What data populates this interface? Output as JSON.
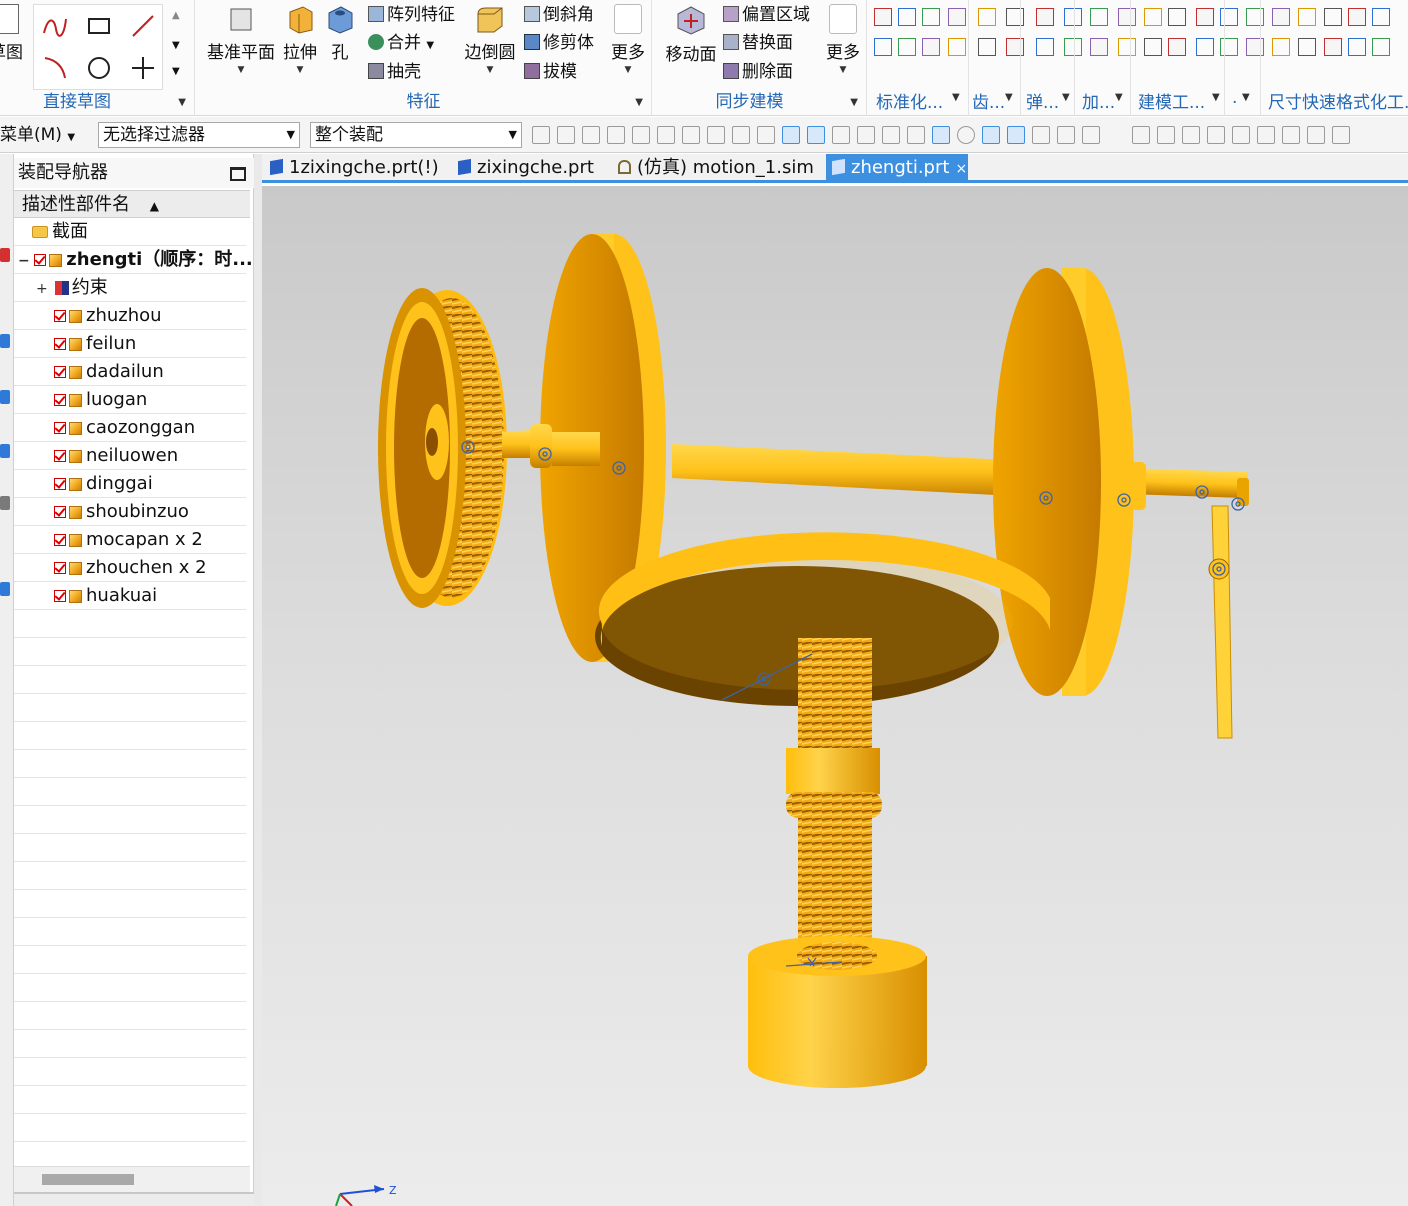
{
  "ribbon": {
    "groups": {
      "direct_sketch": {
        "label": "直接草图",
        "partial_left_label": "草图"
      },
      "feature": {
        "label": "特征",
        "datum_plane": "基准平面",
        "extrude": "拉伸",
        "hole": "孔",
        "pattern_feature": "阵列特征",
        "unite": "合并",
        "shell": "抽壳",
        "edge_blend": "边倒圆",
        "chamfer": "倒斜角",
        "trim_body": "修剪体",
        "draft": "拔模",
        "more": "更多"
      },
      "synchronous": {
        "label": "同步建模",
        "move_face": "移动面",
        "offset_region": "偏置区域",
        "replace_face": "替换面",
        "delete_face": "删除面",
        "more": "更多"
      },
      "tail_labels": [
        "标准化...",
        "齿...",
        "弹...",
        "加...",
        "建模工...",
        ".",
        "尺寸快速格式化工..."
      ]
    }
  },
  "toolbar": {
    "menu_label": "菜单(M)",
    "selection_filter": "无选择过滤器",
    "scope": "整个装配"
  },
  "navigator": {
    "title": "装配导航器",
    "column_header": "描述性部件名",
    "items": [
      {
        "label": "截面",
        "kind": "folder"
      },
      {
        "label": "zhengti（顺序：时...",
        "kind": "assembly"
      },
      {
        "label": "约束",
        "kind": "constraints"
      },
      {
        "label": "zhuzhou",
        "kind": "part"
      },
      {
        "label": "feilun",
        "kind": "part"
      },
      {
        "label": "dadailun",
        "kind": "part"
      },
      {
        "label": "luogan",
        "kind": "part"
      },
      {
        "label": "caozonggan",
        "kind": "part"
      },
      {
        "label": "neiluowen",
        "kind": "part"
      },
      {
        "label": "dinggai",
        "kind": "part"
      },
      {
        "label": "shoubinzuo",
        "kind": "part"
      },
      {
        "label": "mocapan x 2",
        "kind": "part"
      },
      {
        "label": "zhouchen x 2",
        "kind": "part"
      },
      {
        "label": "huakuai",
        "kind": "part"
      }
    ]
  },
  "tabs": [
    {
      "label": "1zixingche.prt(!)",
      "active": false
    },
    {
      "label": "zixingche.prt",
      "active": false
    },
    {
      "label": "(仿真) motion_1.sim",
      "active": false
    },
    {
      "label": "zhengti.prt",
      "active": true,
      "close": "×"
    }
  ],
  "viewport": {
    "triad_label": "Z",
    "colors": {
      "part_light": "#ffc21a",
      "part_mid": "#f0a000",
      "part_dark": "#9a5a00",
      "accent": "#3d8fe0"
    }
  }
}
